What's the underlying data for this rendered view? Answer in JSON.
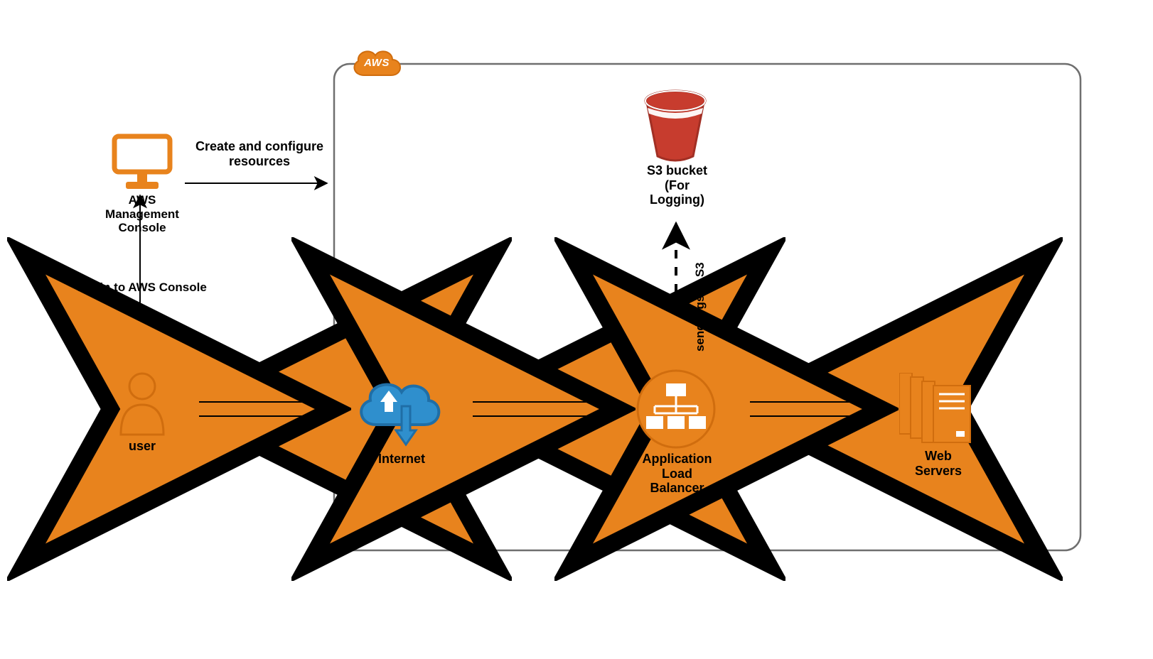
{
  "colors": {
    "orange": "#e8831d",
    "orange_dark": "#d06d0e",
    "blue": "#2f8fcd",
    "blue_dark": "#1f6ea6",
    "red": "#c73c2e",
    "red_dark": "#a22f24",
    "black": "#000000",
    "grey_stroke": "#6f6f6f"
  },
  "cloud_region": {
    "badge_text": "AWS"
  },
  "nodes": {
    "user": {
      "label": "user"
    },
    "console": {
      "label": "AWS\nManagement\nConsole"
    },
    "internet": {
      "label": "Internet"
    },
    "alb": {
      "label": "Application\nLoad\nBalancer"
    },
    "web": {
      "label": "Web\nServers"
    },
    "s3": {
      "label": "S3 bucket\n(For\nLogging)"
    }
  },
  "edges": {
    "login": {
      "label": "Login to AWS Console"
    },
    "create": {
      "label": "Create and configure\nresources"
    },
    "send_logs": {
      "label": "send logs to S3"
    }
  }
}
